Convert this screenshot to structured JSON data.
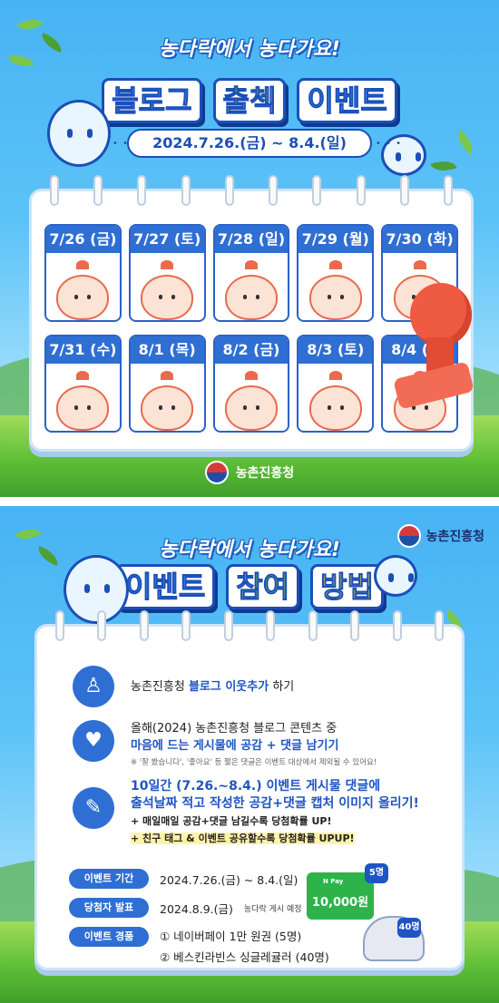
{
  "panel1": {
    "headline": "농다락에서 농다가요!",
    "title_words": [
      "블로그",
      "출첵",
      "이벤트"
    ],
    "period": "2024.7.26.(금) ~ 8.4.(일)",
    "days": [
      "7/26 (금)",
      "7/27 (토)",
      "7/28 (일)",
      "7/29 (월)",
      "7/30 (화)",
      "7/31 (수)",
      "8/1 (목)",
      "8/2 (금)",
      "8/3 (토)",
      "8/4 (일)"
    ],
    "agency": "농촌진흥청"
  },
  "panel2": {
    "headline": "농다락에서 농다가요!",
    "agency": "농촌진흥청",
    "title_words": [
      "이벤트",
      "참여",
      "방법"
    ],
    "step1": {
      "pre": "농촌진흥청 ",
      "hl": "블로그 이웃추가",
      "post": " 하기"
    },
    "step2": {
      "line1": "올해(2024) 농촌진흥청 블로그 콘텐츠 중",
      "line2_hl": "마음에 드는 게시물에 공감 + 댓글 남기기",
      "note": "※ '잘 봤습니다', '좋아요' 등 짧은 댓글은 이벤트 대상에서 제외될 수 있어요!"
    },
    "step3": {
      "line1": "10일간 (7.26.~8.4.) 이벤트 게시물 댓글에",
      "line2": "출석날짜 적고 작성한 공감+댓글 캡처 이미지 올리기!",
      "line3": "+ 매일매일 공감+댓글 남길수록 당첨확률 UP!",
      "line4": "+ 친구 태그 & 이벤트 공유할수록 당첨확률 UPUP!"
    },
    "info": {
      "period_label": "이벤트 기간",
      "period_value": "2024.7.26.(금) ~ 8.4.(일)",
      "winner_label": "당첨자 발표",
      "winner_value": "2024.8.9.(금)",
      "winner_sub": "농다락 게시 예정",
      "prize_label": "이벤트 경품",
      "prize1": "① 네이버페이 1만 원권 (5명)",
      "prize2": "② 베스킨라빈스 싱글레귤러 (40명)"
    },
    "pay_label": "N Pay",
    "pay_amount": "10,000원",
    "badge1": "5명",
    "badge2": "40명"
  },
  "colors": {
    "sky": "#48b3f4",
    "navy": "#1b4fb8",
    "accent": "#2f6fd3",
    "stamp": "#ef5a43",
    "grass": "#5fbf37"
  }
}
